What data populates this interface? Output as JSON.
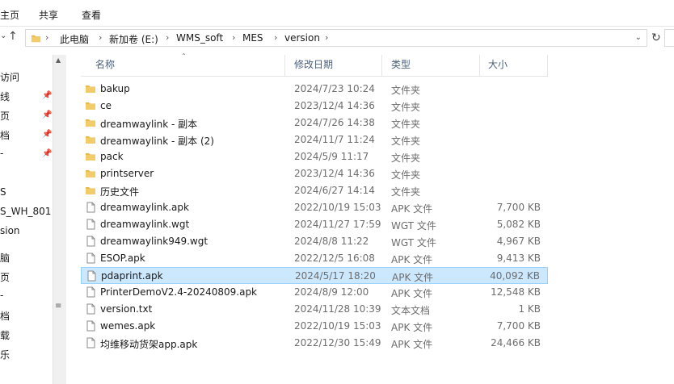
{
  "ribbon": {
    "tabs": [
      "主页",
      "共享",
      "查看"
    ]
  },
  "address": {
    "crumbs": [
      "此电脑",
      "新加卷 (E:)",
      "WMS_soft",
      "MES",
      "version"
    ]
  },
  "left_pane": {
    "items": [
      "访问",
      "线",
      "页",
      "档",
      "-",
      "S",
      "S_WH_801",
      "sion",
      "脑",
      "页",
      "-",
      "档",
      "载",
      "乐"
    ]
  },
  "columns": {
    "name": "名称",
    "date": "修改日期",
    "type": "类型",
    "size": "大小"
  },
  "files": [
    {
      "name": "bakup",
      "date": "2024/7/23 10:24",
      "type": "文件夹",
      "size": "",
      "kind": "folder"
    },
    {
      "name": "ce",
      "date": "2023/12/4 14:36",
      "type": "文件夹",
      "size": "",
      "kind": "folder"
    },
    {
      "name": "dreamwaylink - 副本",
      "date": "2024/7/26 14:38",
      "type": "文件夹",
      "size": "",
      "kind": "folder"
    },
    {
      "name": "dreamwaylink - 副本 (2)",
      "date": "2024/11/7 11:24",
      "type": "文件夹",
      "size": "",
      "kind": "folder"
    },
    {
      "name": "pack",
      "date": "2024/5/9 11:17",
      "type": "文件夹",
      "size": "",
      "kind": "folder"
    },
    {
      "name": "printserver",
      "date": "2023/12/4 14:36",
      "type": "文件夹",
      "size": "",
      "kind": "folder"
    },
    {
      "name": "历史文件",
      "date": "2024/6/27 14:14",
      "type": "文件夹",
      "size": "",
      "kind": "folder"
    },
    {
      "name": "dreamwaylink.apk",
      "date": "2022/10/19 15:03",
      "type": "APK 文件",
      "size": "7,700 KB",
      "kind": "file"
    },
    {
      "name": "dreamwaylink.wgt",
      "date": "2024/11/27 17:59",
      "type": "WGT 文件",
      "size": "5,082 KB",
      "kind": "file"
    },
    {
      "name": "dreamwaylink949.wgt",
      "date": "2024/8/8 11:22",
      "type": "WGT 文件",
      "size": "4,967 KB",
      "kind": "file"
    },
    {
      "name": "ESOP.apk",
      "date": "2022/12/5 16:08",
      "type": "APK 文件",
      "size": "9,413 KB",
      "kind": "file"
    },
    {
      "name": "pdaprint.apk",
      "date": "2024/5/17 18:20",
      "type": "APK 文件",
      "size": "40,092 KB",
      "kind": "file",
      "selected": true
    },
    {
      "name": "PrinterDemoV2.4-20240809.apk",
      "date": "2024/8/9 12:00",
      "type": "APK 文件",
      "size": "12,548 KB",
      "kind": "file"
    },
    {
      "name": "version.txt",
      "date": "2024/11/28 10:39",
      "type": "文本文档",
      "size": "1 KB",
      "kind": "file"
    },
    {
      "name": "wemes.apk",
      "date": "2022/10/19 15:03",
      "type": "APK 文件",
      "size": "7,700 KB",
      "kind": "file"
    },
    {
      "name": "均维移动货架app.apk",
      "date": "2022/12/30 15:49",
      "type": "APK 文件",
      "size": "24,466 KB",
      "kind": "file"
    }
  ],
  "colors": {
    "folder": "#e8b84a",
    "selection_bg": "#cce8ff",
    "selection_border": "#99d1ff",
    "header_text": "#4c607a"
  }
}
